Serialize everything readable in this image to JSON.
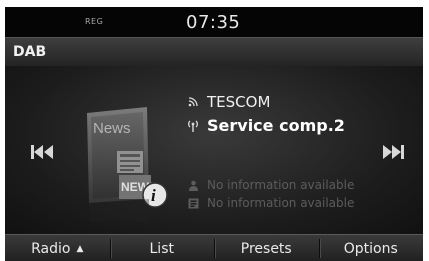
{
  "status": {
    "reg": "REG",
    "time": "07:35"
  },
  "header": {
    "title": "DAB"
  },
  "main": {
    "ensemble": "TESCOM",
    "service": "Service comp.2",
    "artist_info": "No information available",
    "title_info": "No information available",
    "artwork": {
      "label": "News",
      "label2": "NEWS",
      "badge": "i"
    }
  },
  "icons": {
    "prev": "skip-previous-icon",
    "next": "skip-next-icon",
    "ensemble": "signal-icon",
    "service": "broadcast-icon",
    "artist": "person-icon",
    "album": "album-icon"
  },
  "bottom": {
    "tabs": [
      {
        "label": "Radio",
        "arrow": "▲"
      },
      {
        "label": "List"
      },
      {
        "label": "Presets"
      },
      {
        "label": "Options"
      }
    ]
  },
  "colors": {
    "background": "#141414",
    "text": "#f0f0f0",
    "dim_text": "#5c5c5c"
  }
}
